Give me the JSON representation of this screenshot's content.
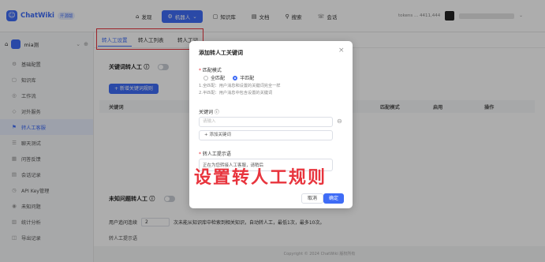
{
  "app": {
    "name": "ChatWiki",
    "tag": "开源版"
  },
  "nav": [
    {
      "icon": "⌂",
      "label": "发现",
      "active": false
    },
    {
      "icon": "⚙",
      "label": "机器人",
      "active": true
    },
    {
      "icon": "▢",
      "label": "知识库",
      "active": false
    },
    {
      "icon": "▤",
      "label": "文档",
      "active": false
    },
    {
      "icon": "⚲",
      "label": "搜索",
      "active": false
    },
    {
      "icon": "☏",
      "label": "会话",
      "active": false
    }
  ],
  "topright": {
    "usage": "tokens ... 4411,444"
  },
  "robot": {
    "name": "mia测"
  },
  "sidebar": [
    {
      "icon": "⚙",
      "label": "基础配置",
      "active": false
    },
    {
      "icon": "▢",
      "label": "知识库",
      "active": false
    },
    {
      "icon": "◎",
      "label": "工作流",
      "active": false
    },
    {
      "icon": "◇",
      "label": "对外服务",
      "active": false
    },
    {
      "icon": "⚑",
      "label": "转人工客服",
      "active": true
    },
    {
      "icon": "☰",
      "label": "聊天测试",
      "active": false
    },
    {
      "icon": "▦",
      "label": "问答反馈",
      "active": false
    },
    {
      "icon": "▤",
      "label": "会话记录",
      "active": false
    },
    {
      "icon": "◷",
      "label": "API Key管理",
      "active": false
    },
    {
      "icon": "◉",
      "label": "未知问题",
      "active": false
    },
    {
      "icon": "▥",
      "label": "统计分析",
      "active": false
    },
    {
      "icon": "◫",
      "label": "导出记录",
      "active": false
    }
  ],
  "tabs": [
    {
      "label": "转人工设置",
      "active": true
    },
    {
      "label": "转人工列表",
      "active": false
    },
    {
      "label": "转人工记",
      "active": false
    }
  ],
  "keyword_section": {
    "title": "关键词转人工 ⓘ",
    "add_button": "+ 新增关键词规则"
  },
  "table": {
    "headers": [
      "关键词",
      "匹配模式",
      "启用",
      "操作"
    ]
  },
  "unknown_section": {
    "title": "未知问题转人工 ⓘ",
    "row_label": "用户追问连续",
    "row_value": "2",
    "row_text": "次未能从知识库中检索到相关知识，自动转人工，最低1次，最多10次。",
    "row2_text": "转人工提示语"
  },
  "footer": "Copyright © 2024 ChatWiki 版权所有",
  "modal": {
    "title": "添加转人工关键词",
    "match_label": "匹配模式",
    "match_options": [
      {
        "label": "全匹配",
        "checked": false
      },
      {
        "label": "半匹配",
        "checked": true
      }
    ],
    "hint1": "1.全匹配：用户消息和设置的关键词完全一样",
    "hint2": "2.半匹配：用户消息中包含设置的关键词",
    "keyword_label": "关键词 ⓘ",
    "keyword_placeholder": "请输入",
    "add_keyword": "+ 添加关键词",
    "prompt_label": "转人工提示语",
    "prompt_value": "正在为您转接人工客服，请稍后",
    "cancel": "取消",
    "confirm": "确定"
  },
  "caption": "设置转人工规则"
}
